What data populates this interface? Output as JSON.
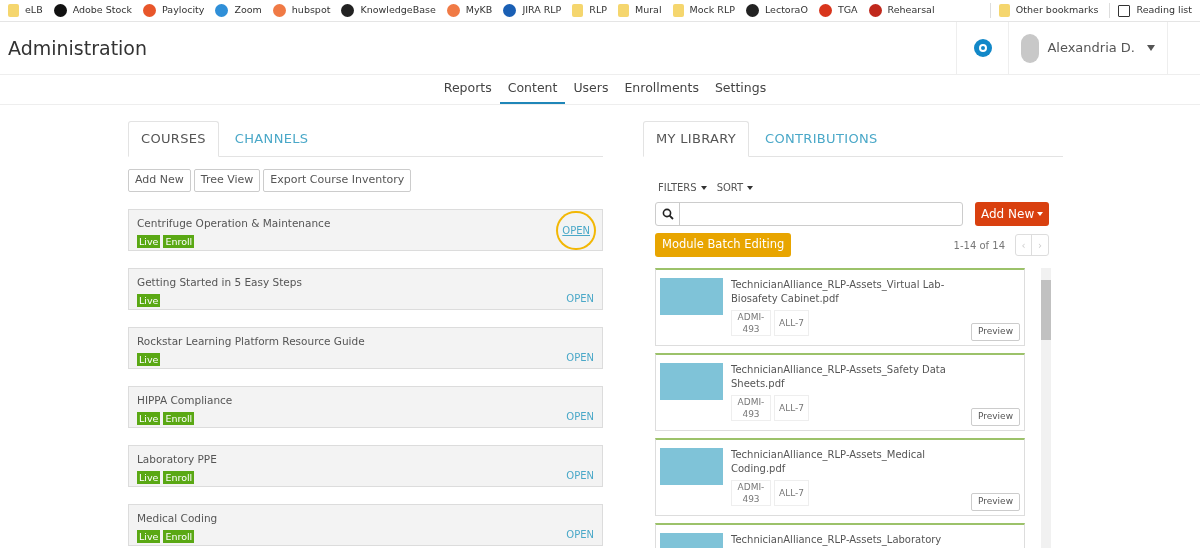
{
  "bookmarks": [
    {
      "label": "eLB",
      "kind": "folder"
    },
    {
      "label": "Adobe Stock",
      "kind": "site"
    },
    {
      "label": "Paylocity",
      "kind": "site"
    },
    {
      "label": "Zoom",
      "kind": "site"
    },
    {
      "label": "hubspot",
      "kind": "site"
    },
    {
      "label": "KnowledgeBase",
      "kind": "site"
    },
    {
      "label": "MyKB",
      "kind": "site"
    },
    {
      "label": "JIRA RLP",
      "kind": "site"
    },
    {
      "label": "RLP",
      "kind": "folder"
    },
    {
      "label": "Mural",
      "kind": "folder"
    },
    {
      "label": "Mock RLP",
      "kind": "folder"
    },
    {
      "label": "LectoraO",
      "kind": "site"
    },
    {
      "label": "TGA",
      "kind": "site"
    },
    {
      "label": "Rehearsal",
      "kind": "site"
    }
  ],
  "bookmarks_right": [
    {
      "label": "Other bookmarks",
      "kind": "folder"
    },
    {
      "label": "Reading list",
      "kind": "list"
    }
  ],
  "header": {
    "title": "Administration",
    "user": "Alexandria D."
  },
  "nav": [
    {
      "label": "Reports",
      "selected": false
    },
    {
      "label": "Content",
      "selected": true
    },
    {
      "label": "Users",
      "selected": false
    },
    {
      "label": "Enrollments",
      "selected": false
    },
    {
      "label": "Settings",
      "selected": false
    }
  ],
  "left_tabs": [
    {
      "label": "COURSES",
      "selected": true
    },
    {
      "label": "CHANNELS",
      "selected": false
    }
  ],
  "left_buttons": [
    "Add New",
    "Tree View",
    "Export Course Inventory"
  ],
  "courses": [
    {
      "title": "Centrifuge Operation & Maintenance",
      "badges": [
        "Live",
        "Enroll"
      ],
      "action": "OPEN",
      "hovered": true
    },
    {
      "title": "Getting Started in 5 Easy Steps",
      "badges": [
        "Live"
      ],
      "action": "OPEN",
      "hovered": false
    },
    {
      "title": "Rockstar Learning Platform Resource Guide",
      "badges": [
        "Live"
      ],
      "action": "OPEN",
      "hovered": false
    },
    {
      "title": "HIPPA Compliance",
      "badges": [
        "Live",
        "Enroll"
      ],
      "action": "OPEN",
      "hovered": false
    },
    {
      "title": "Laboratory PPE",
      "badges": [
        "Live",
        "Enroll"
      ],
      "action": "OPEN",
      "hovered": false
    },
    {
      "title": "Medical Coding",
      "badges": [
        "Live",
        "Enroll"
      ],
      "action": "OPEN",
      "hovered": false
    }
  ],
  "right_tabs": [
    {
      "label": "MY LIBRARY",
      "selected": true
    },
    {
      "label": "CONTRIBUTIONS",
      "selected": false
    }
  ],
  "filters": [
    "FILTERS",
    "SORT"
  ],
  "add_new": "Add New",
  "batch_button": "Module Batch Editing",
  "pagination": "1-14 of 14",
  "pager": [
    "‹",
    "›"
  ],
  "library": [
    {
      "title": "TechnicianAlliance_RLP-Assets_Virtual Lab-Biosafety Cabinet.pdf",
      "tags": [
        "ADMI-493",
        "ALL-7"
      ],
      "action": "Preview"
    },
    {
      "title": "TechnicianAlliance_RLP-Assets_Safety Data Sheets.pdf",
      "tags": [
        "ADMI-493",
        "ALL-7"
      ],
      "action": "Preview"
    },
    {
      "title": "TechnicianAlliance_RLP-Assets_Medical Coding.pdf",
      "tags": [
        "ADMI-493",
        "ALL-7"
      ],
      "action": "Preview"
    },
    {
      "title": "TechnicianAlliance_RLP-Assets_Laboratory"
    }
  ]
}
